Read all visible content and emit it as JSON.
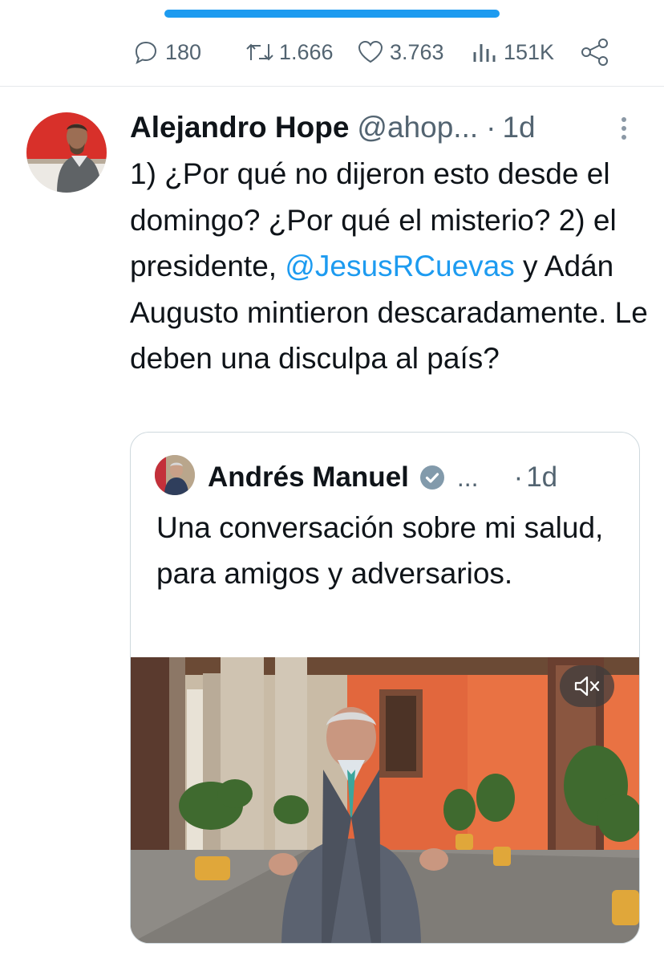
{
  "actions": {
    "replies": "180",
    "retweets": "1.666",
    "likes": "3.763",
    "views": "151K"
  },
  "tweet": {
    "author_name": "Alejandro Hope",
    "handle": "@ahop...",
    "separator": "·",
    "time": "1d",
    "text_before": "1) ¿Por qué no dijeron esto desde el domingo? ¿Por qué el misterio? 2) el presidente, ",
    "mention": "@JesusRCuevas",
    "text_after": " y Adán Augusto mintieron descaradamente. Le deben una disculpa al país?"
  },
  "quote": {
    "author_name": "Andrés Manuel",
    "ellipsis": "...",
    "separator": "·",
    "time": "1d",
    "text": "Una conversación sobre mi salud, para amigos y adversarios."
  },
  "colors": {
    "accent": "#1d9bf0",
    "muted": "#536471",
    "wall_orange": "#e0643a"
  }
}
